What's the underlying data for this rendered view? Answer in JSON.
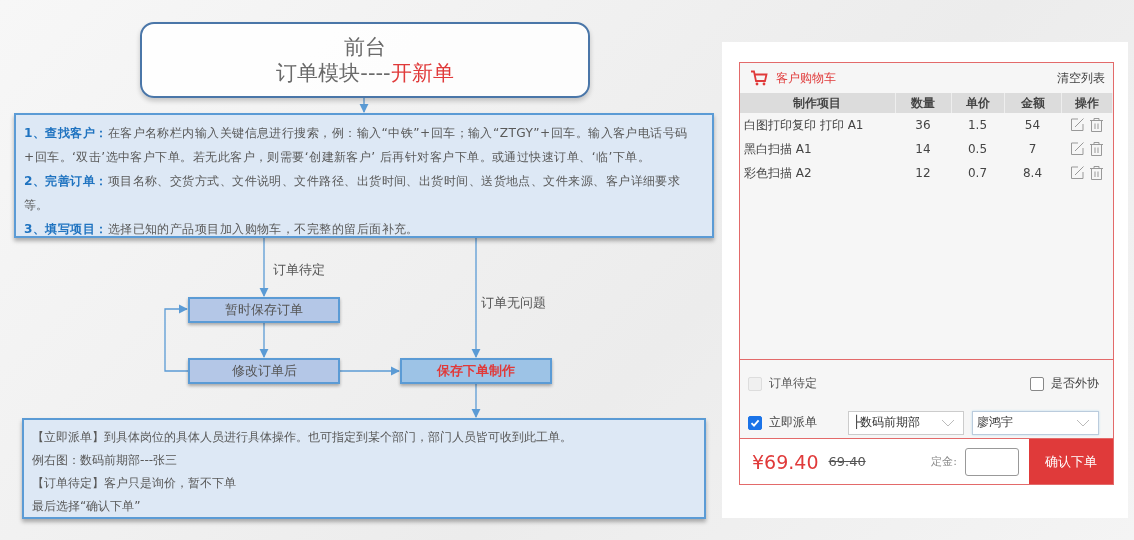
{
  "diagram": {
    "title": {
      "line1": "前台",
      "line2": "订单模块----",
      "line2_highlight": "开新单"
    },
    "steps_box": {
      "paragraphs": [
        "**1、查找客户：**在客户名称栏内输入关键信息进行搜索，例：输入“中铁”+回车；输入“ZTGY”+回车。输入客户电话号码+回车。‘双击’选中客户下单。若无此客户，则需要‘创建新客户’ 后再针对客户下单。或通过快速订单、‘临’下单。",
        "**2、完善订单：**项目名称、交货方式、文件说明、文件路径、出货时间、出货时间、送货地点、文件来源、客户详细要求等。",
        "**3、填写项目：**选择已知的产品项目加入购物车，不完整的留后面补充。"
      ]
    },
    "edge_labels": [
      "订单待定",
      "订单无问题"
    ],
    "nodes": [
      {
        "label": "暂时保存订单",
        "kind": "normal"
      },
      {
        "label": "修改订单后",
        "kind": "normal"
      },
      {
        "label": "保存下单制作",
        "kind": "highlight"
      }
    ],
    "notes_box": {
      "lines": [
        "【立即派单】到具体岗位的具体人员进行具体操作。也可指定到某个部门，部门人员皆可收到此工单。",
        "例右图：数码前期部---张三",
        "【订单待定】客户只是询价，暂不下单",
        "最后选择“确认下单”"
      ]
    }
  },
  "cart": {
    "title": "客户购物车",
    "clear_link": "清空列表",
    "columns": [
      "制作项目",
      "数量",
      "单价",
      "金额",
      "操作"
    ],
    "rows": [
      {
        "item": "白图打印复印 打印 A1",
        "qty": "36",
        "price": "1.5",
        "amount": "54"
      },
      {
        "item": "黑白扫描 A1",
        "qty": "14",
        "price": "0.5",
        "amount": "7"
      },
      {
        "item": "彩色扫描 A2",
        "qty": "12",
        "price": "0.7",
        "amount": "8.4"
      }
    ],
    "options": [
      {
        "label": "订单待定",
        "checked": false,
        "disabled": true
      },
      {
        "label": "是否外协",
        "checked": false,
        "disabled": false
      },
      {
        "label": "立即派单",
        "checked": true,
        "disabled": false
      }
    ],
    "department_select": {
      "value": "├数码前期部"
    },
    "staff_select": {
      "value": "廖鸿宇"
    },
    "total": "¥69.40",
    "original_total": "69.40",
    "deposit_label": "定金:",
    "confirm_button": "确认下单"
  }
}
